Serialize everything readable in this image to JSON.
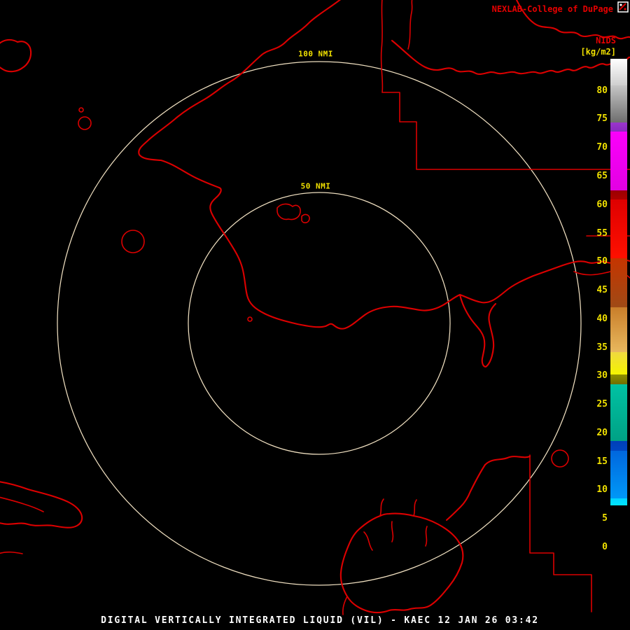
{
  "colors": {
    "background": "#000000",
    "map_outline": "#DC0000",
    "range_ring": "#EFDFC0",
    "label_yellow": "#F0E000",
    "title_red": "#E60000",
    "footer_text": "#FFFFFF"
  },
  "header": {
    "title": "NEXLAB-College of DuPage"
  },
  "colorbar": {
    "product": "NIDS",
    "units": "[kg/m2]",
    "scale_max": 85.6,
    "ticks": [
      80,
      75,
      70,
      65,
      60,
      55,
      50,
      45,
      40,
      35,
      30,
      25,
      20,
      15,
      10,
      5,
      0
    ],
    "segments": [
      {
        "from": 85.6,
        "to": 81.0,
        "top": "#FFFFFF",
        "bottom": "#CFCFCF"
      },
      {
        "from": 81.0,
        "to": 74.5,
        "top": "#C6C6C6",
        "bottom": "#6E6E6E"
      },
      {
        "from": 74.5,
        "to": 72.8,
        "top": "#9A35CD",
        "bottom": "#8A2BBF"
      },
      {
        "from": 72.8,
        "to": 62.6,
        "top": "#FB00FB",
        "bottom": "#E300E3"
      },
      {
        "from": 62.6,
        "to": 61.0,
        "top": "#9B0000",
        "bottom": "#AD0000"
      },
      {
        "from": 61.0,
        "to": 50.6,
        "top": "#DE0000",
        "bottom": "#FF1000"
      },
      {
        "from": 50.6,
        "to": 42.0,
        "top": "#C53500",
        "bottom": "#9F4A16"
      },
      {
        "from": 42.0,
        "to": 34.2,
        "top": "#C97E2A",
        "bottom": "#E8B85E"
      },
      {
        "from": 34.2,
        "to": 30.3,
        "top": "#EFD93F",
        "bottom": "#F4F400"
      },
      {
        "from": 30.3,
        "to": 28.6,
        "top": "#8F8F00",
        "bottom": "#6F6F00"
      },
      {
        "from": 28.6,
        "to": 18.6,
        "top": "#00C2A3",
        "bottom": "#00A185"
      },
      {
        "from": 18.6,
        "to": 16.9,
        "top": "#003FB7",
        "bottom": "#0046C2"
      },
      {
        "from": 16.9,
        "to": 8.6,
        "top": "#0067DE",
        "bottom": "#0098F7"
      },
      {
        "from": 8.6,
        "to": 7.3,
        "top": "#00D5FF",
        "bottom": "#00E4FF"
      },
      {
        "from": 7.3,
        "to": 0.0,
        "top": "#000000",
        "bottom": "#000000"
      }
    ]
  },
  "range_rings": [
    {
      "label": "100 NMI"
    },
    {
      "label": "50 NMI"
    }
  ],
  "footer": {
    "text": "DIGITAL VERTICALLY INTEGRATED LIQUID (VIL) - KAEC 12 JAN 26 03:42"
  }
}
